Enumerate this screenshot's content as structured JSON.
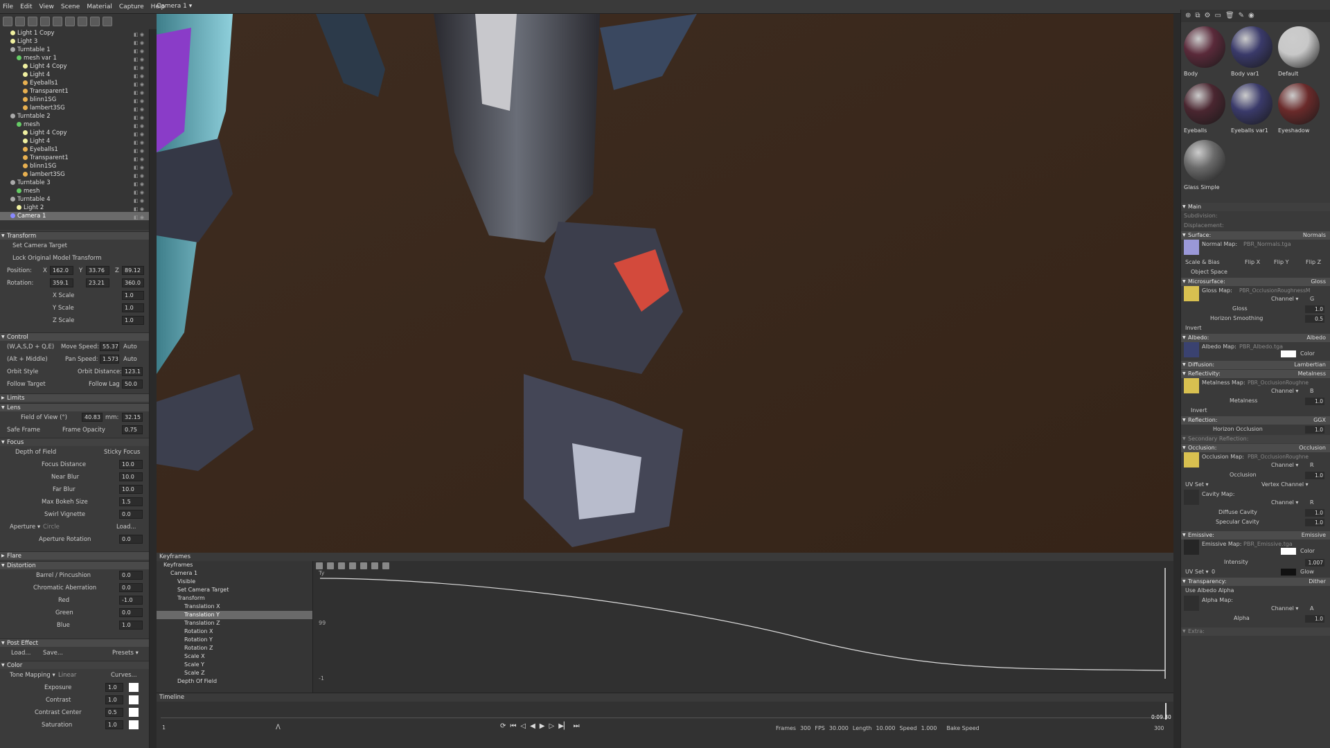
{
  "app": {
    "menu": [
      "File",
      "Edit",
      "View",
      "Scene",
      "Material",
      "Capture",
      "Help"
    ],
    "camera_button": "Camera 1 ▾"
  },
  "scene": [
    {
      "label": "Light 1 Copy",
      "depth": 1,
      "color": "#f0f0a0"
    },
    {
      "label": "Light 3",
      "depth": 1,
      "color": "#f0f0a0"
    },
    {
      "label": "Turntable 1",
      "depth": 1,
      "color": "#aaa"
    },
    {
      "label": "mesh var 1",
      "depth": 2,
      "color": "#6c6"
    },
    {
      "label": "Light 4 Copy",
      "depth": 3,
      "color": "#f0f0a0"
    },
    {
      "label": "Light 4",
      "depth": 3,
      "color": "#f0f0a0"
    },
    {
      "label": "Eyeballs1",
      "depth": 3,
      "color": "#e8b050"
    },
    {
      "label": "Transparent1",
      "depth": 3,
      "color": "#e8b050"
    },
    {
      "label": "blinn1SG",
      "depth": 3,
      "color": "#e8b050"
    },
    {
      "label": "lambert3SG",
      "depth": 3,
      "color": "#e8b050"
    },
    {
      "label": "Turntable 2",
      "depth": 1,
      "color": "#aaa"
    },
    {
      "label": "mesh",
      "depth": 2,
      "color": "#6c6"
    },
    {
      "label": "Light 4 Copy",
      "depth": 3,
      "color": "#f0f0a0"
    },
    {
      "label": "Light 4",
      "depth": 3,
      "color": "#f0f0a0"
    },
    {
      "label": "Eyeballs1",
      "depth": 3,
      "color": "#e8b050"
    },
    {
      "label": "Transparent1",
      "depth": 3,
      "color": "#e8b050"
    },
    {
      "label": "blinn1SG",
      "depth": 3,
      "color": "#e8b050"
    },
    {
      "label": "lambert3SG",
      "depth": 3,
      "color": "#e8b050"
    },
    {
      "label": "Turntable 3",
      "depth": 1,
      "color": "#aaa"
    },
    {
      "label": "mesh",
      "depth": 2,
      "color": "#6c6"
    },
    {
      "label": "Turntable 4",
      "depth": 1,
      "color": "#aaa"
    },
    {
      "label": "Light 2",
      "depth": 2,
      "color": "#f0f0a0"
    },
    {
      "label": "Camera 1",
      "depth": 1,
      "color": "#88f",
      "selected": true
    }
  ],
  "transform": {
    "title": "Transform",
    "set_target": "Set Camera Target",
    "lock": "Lock Original Model Transform",
    "position_label": "Position:",
    "rotation_label": "Rotation:",
    "px": "162.0",
    "py": "33.76",
    "pz": "89.12",
    "rx": "359.1",
    "ry": "23.21",
    "rz": "360.0",
    "xscale": "X Scale",
    "yscale": "Y Scale",
    "zscale": "Z Scale",
    "scale_val": "1.0"
  },
  "control": {
    "title": "Control",
    "wasd": "(W,A,S,D + Q,E)",
    "move_speed": "Move Speed:",
    "move_val": "55.37",
    "auto": "Auto",
    "alt": "(Alt + Middle)",
    "pan_speed": "Pan Speed:",
    "pan_val": "1.573",
    "orbit_style": "Orbit Style",
    "orbit_dist": "Orbit Distance:",
    "orbit_val": "123.1",
    "follow": "Follow Target",
    "follow_lag": "Follow Lag",
    "follow_val": "50.0"
  },
  "limits": "Limits",
  "lens": {
    "title": "Lens",
    "fov": "Field of View (°)",
    "fov_val": "40.83",
    "mm": "mm:",
    "mm_val": "32.15",
    "safe": "Safe Frame",
    "frame_opacity": "Frame Opacity",
    "opacity_val": "0.75",
    "focus": "Focus",
    "dof": "Depth of Field",
    "sticky": "Sticky Focus",
    "focus_dist": "Focus Distance",
    "focus_val": "10.0",
    "near": "Near Blur",
    "near_val": "10.0",
    "far": "Far Blur",
    "far_val": "10.0",
    "bokeh": "Max Bokeh Size",
    "bokeh_val": "1.5",
    "swirl": "Swirl Vignette",
    "swirl_val": "0.0",
    "aperture": "Aperture ▾",
    "circle": "Circle",
    "load": "Load...",
    "ap_rot": "Aperture Rotation",
    "ap_rot_val": "0.0"
  },
  "flare": "Flare",
  "distortion": {
    "title": "Distortion",
    "barrel": "Barrel / Pincushion",
    "barrel_val": "0.0",
    "chrom": "Chromatic Aberration",
    "chrom_val": "0.0",
    "red": "Red",
    "red_val": "-1.0",
    "green": "Green",
    "green_val": "0.0",
    "blue": "Blue",
    "blue_val": "1.0"
  },
  "post": {
    "title": "Post Effect",
    "load": "Load...",
    "save": "Save...",
    "presets": "Presets ▾",
    "color": "Color",
    "tone": "Tone Mapping ▾",
    "linear": "Linear",
    "curves": "Curves...",
    "exposure": "Exposure",
    "contrast": "Contrast",
    "contrast_center": "Contrast Center",
    "saturation": "Saturation",
    "v1": "1.0",
    "v2": "1.0",
    "v3": "0.5",
    "v4": "1.0"
  },
  "keyframes": {
    "title": "Keyframes",
    "tree": [
      {
        "label": "Keyframes",
        "d": 0
      },
      {
        "label": "Camera 1",
        "d": 1
      },
      {
        "label": "Visible",
        "d": 2
      },
      {
        "label": "Set Camera Target",
        "d": 2
      },
      {
        "label": "Transform",
        "d": 2
      },
      {
        "label": "Translation X",
        "d": 3
      },
      {
        "label": "Translation Y",
        "d": 3,
        "sel": true
      },
      {
        "label": "Translation Z",
        "d": 3
      },
      {
        "label": "Rotation X",
        "d": 3
      },
      {
        "label": "Rotation Y",
        "d": 3
      },
      {
        "label": "Rotation Z",
        "d": 3
      },
      {
        "label": "Scale X",
        "d": 3
      },
      {
        "label": "Scale Y",
        "d": 3
      },
      {
        "label": "Scale Z",
        "d": 3
      },
      {
        "label": "Depth Of Field",
        "d": 2
      }
    ],
    "ty": "Ty",
    "y_top": "99",
    "y_bottom": "-1"
  },
  "timeline": {
    "title": "Timeline",
    "frame": "1",
    "frames_lbl": "Frames",
    "frames": "300",
    "fps_lbl": "FPS",
    "fps": "30.000",
    "length_lbl": "Length",
    "length": "10.000",
    "speed_lbl": "Speed",
    "speed": "1.000",
    "bake": "Bake Speed",
    "time": "0:09.30",
    "end": "300"
  },
  "materials": [
    {
      "name": "Body",
      "color": "#5a2a3a"
    },
    {
      "name": "Body var1",
      "color": "#3a3a6a"
    },
    {
      "name": "Default",
      "color": "#c8c8c8"
    },
    {
      "name": "Eyeballs",
      "color": "#4a2630"
    },
    {
      "name": "Eyeballs var1",
      "color": "#3a3a6a"
    },
    {
      "name": "Eyeshadow",
      "color": "#6a2a2a"
    },
    {
      "name": "Glass Simple",
      "color": "#6a6a6a"
    }
  ],
  "props": {
    "main": "Main",
    "subdivision": "Subdivision:",
    "displacement": "Displacement:",
    "surface": "Surface:",
    "normals": "Normals",
    "normal_map": "Normal Map:",
    "normal_file": "PBR_Normals.tga",
    "scale_bias": "Scale & Bias",
    "flipx": "Flip X",
    "flipy": "Flip Y",
    "flipz": "Flip Z",
    "object_space": "Object Space",
    "micro": "Microsurface:",
    "gloss_mode": "Gloss",
    "gloss_map": "Gloss Map:",
    "gloss_file": "PBR_OcclusionRoughnessM",
    "channel": "Channel ▾",
    "gloss": "Gloss",
    "horizon": "Horizon Smoothing",
    "hs_val": "0.5",
    "invert": "Invert",
    "albedo": "Albedo:",
    "albedo_mode": "Albedo",
    "albedo_map": "Albedo Map:",
    "albedo_file": "PBR_Albedo.tga",
    "color": "Color",
    "diffusion": "Diffusion:",
    "lambertian": "Lambertian",
    "reflectivity": "Reflectivity:",
    "metalness_mode": "Metalness",
    "metal_map": "Metalness Map:",
    "metal_file": "PBR_OcclusionRoughne",
    "metalness": "Metalness",
    "reflection": "Reflection:",
    "ggx": "GGX",
    "horizon_occ": "Horizon Occlusion",
    "second": "Secondary Reflection:",
    "occlusion": "Occlusion:",
    "occ_mode": "Occlusion",
    "occ_map": "Occlusion Map:",
    "occ_file": "PBR_OcclusionRoughne",
    "occ": "Occlusion",
    "uvset": "UV Set ▾",
    "vertex": "Vertex Channel ▾",
    "cavity_map": "Cavity Map:",
    "diffuse_cav": "Diffuse Cavity",
    "specular_cav": "Specular Cavity",
    "emissive": "Emissive:",
    "em_mode": "Emissive",
    "em_map": "Emissive Map:",
    "em_file": "PBR_Emissive.tga",
    "intensity": "Intensity",
    "int_val": "1.007",
    "glow": "Glow",
    "transparency": "Transparency:",
    "dither": "Dither",
    "use_alpha": "Use Albedo Alpha",
    "alpha_map": "Alpha Map:",
    "alpha": "Alpha",
    "extra": "Extra:",
    "one": "1.0",
    "channel_g": "G",
    "channel_b": "B",
    "channel_r": "R",
    "channel_a": "A",
    "uvset0": "0"
  }
}
